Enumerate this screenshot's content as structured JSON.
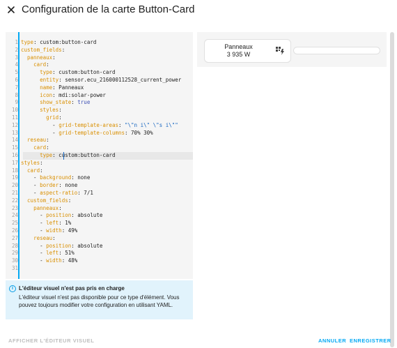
{
  "dialog": {
    "title": "Configuration de la carte Button-Card"
  },
  "editor": {
    "line_numbers": [
      "1",
      "2",
      "3",
      "4",
      "5",
      "6",
      "7",
      "8",
      "9",
      "10",
      "11",
      "12",
      "13",
      "14",
      "15",
      "16",
      "17",
      "18",
      "19",
      "20",
      "21",
      "22",
      "23",
      "24",
      "25",
      "26",
      "27",
      "28",
      "29",
      "30",
      "31"
    ],
    "lines": [
      "type: custom:button-card",
      "custom_fields:",
      "  panneaux:",
      "    card:",
      "      type: custom:button-card",
      "      entity: sensor.ecu_216000112528_current_power",
      "      name: Panneaux",
      "      icon: mdi:solar-power",
      "      show_state: true",
      "      styles:",
      "        grid:",
      "          - grid-template-areas: \"\\\"n i\\\" \\\"s i\\\"\"",
      "          - grid-template-columns: 70% 30%",
      "  reseau:",
      "    card:",
      "      type: custom:button-card",
      "styles:",
      "  card:",
      "    - background: none",
      "    - border: none",
      "    - aspect-ratio: 7/1",
      "  custom_fields:",
      "    panneaux:",
      "      - position: absolute",
      "      - left: 1%",
      "      - width: 49%",
      "    reseau:",
      "      - position: absolute",
      "      - left: 51%",
      "      - width: 48%",
      ""
    ]
  },
  "notice": {
    "title": "L'éditeur visuel n'est pas pris en charge",
    "text": "L'éditeur visuel n'est pas disponible pour ce type d'élément. Vous pouvez toujours modifier votre configuration en utilisant YAML."
  },
  "preview": {
    "card_name": "Panneaux",
    "card_state": "3 935 W",
    "card_icon": "solar-power-icon"
  },
  "footer": {
    "show_visual_editor": "AFFICHER L'ÉDITEUR VISUEL",
    "cancel": "ANNULER",
    "save": "ENREGISTRER"
  },
  "colors": {
    "accent": "#03a9f4",
    "yaml_key": "#d98f00",
    "yaml_bool": "#3f51b5",
    "notice_bg": "#e1f3fc"
  }
}
